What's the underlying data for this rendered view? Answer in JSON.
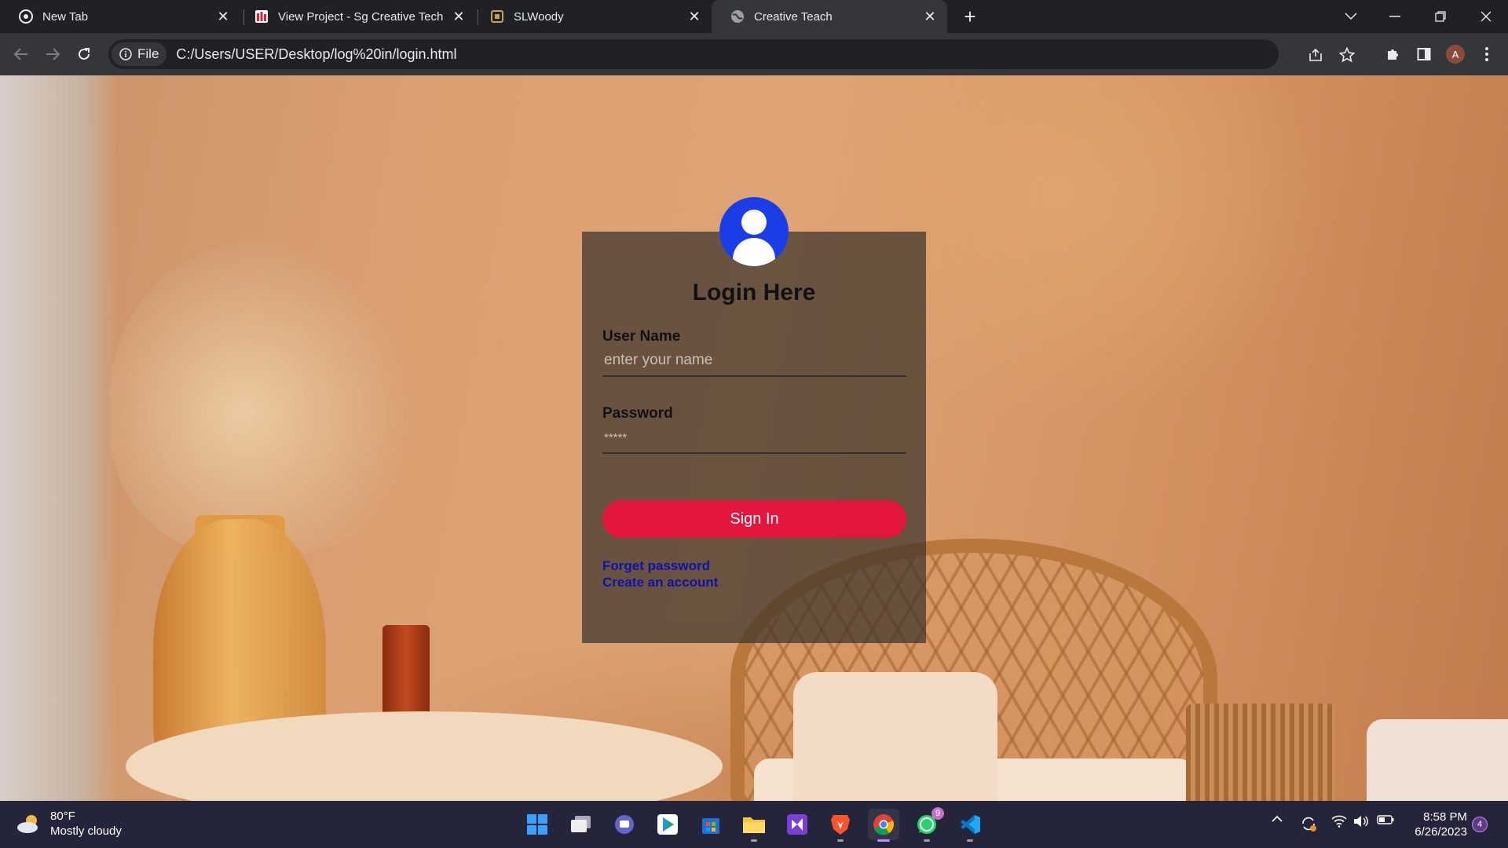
{
  "browser": {
    "tabs": [
      {
        "label": "New Tab",
        "icon": "chrome-icon",
        "active": false
      },
      {
        "label": "View Project - Sg Creative Tech",
        "icon": "project-favicon",
        "active": false
      },
      {
        "label": "SLWoody",
        "icon": "slwoody-favicon",
        "active": false
      },
      {
        "label": "Creative Teach",
        "icon": "globe-icon",
        "active": true
      }
    ],
    "site_chip": "File",
    "url": "C:/Users/USER/Desktop/log%20in/login.html",
    "profile_initial": "A"
  },
  "login": {
    "title": "Login Here",
    "username_label": "User Name",
    "username_placeholder": "enter your name",
    "password_label": "Password",
    "password_placeholder": "*****",
    "signin_label": "Sign In",
    "forgot_link": "Forget password",
    "create_link": "Create an account",
    "colors": {
      "button": "#e3163f",
      "avatar": "#1a3de8",
      "links": "#0f12a8"
    }
  },
  "taskbar": {
    "weather_temp": "80°F",
    "weather_desc": "Mostly cloudy",
    "whatsapp_badge": "9",
    "clock_time": "8:58 PM",
    "clock_date": "6/26/2023",
    "notification_count": "4"
  }
}
